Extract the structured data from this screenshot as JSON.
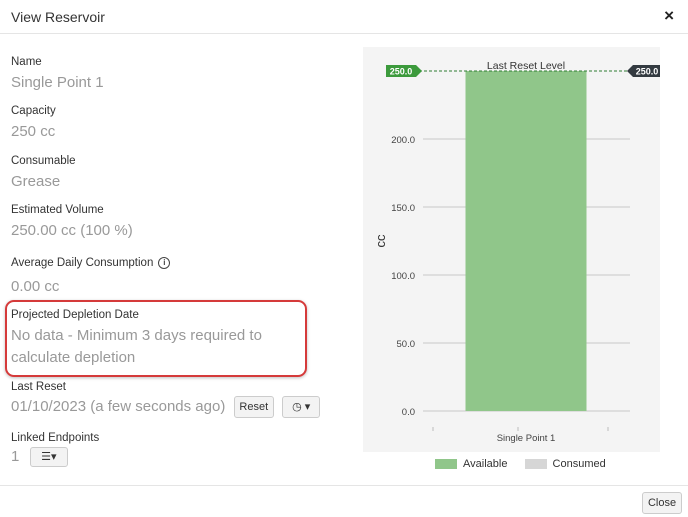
{
  "dialog": {
    "title": "View Reservoir",
    "close_symbol": "×"
  },
  "fields": {
    "name": {
      "label": "Name",
      "value": "Single Point 1"
    },
    "capacity": {
      "label": "Capacity",
      "value": "250 cc"
    },
    "consumable": {
      "label": "Consumable",
      "value": "Grease"
    },
    "estimated_volume": {
      "label": "Estimated Volume",
      "value": "250.00 cc (100 %)"
    },
    "avg_daily": {
      "label": "Average Daily Consumption",
      "info_symbol": "i",
      "value": "0.00 cc"
    },
    "projected": {
      "label": "Projected Depletion Date",
      "value_line1": "No data - Minimum 3 days required to",
      "value_line2": "calculate depletion"
    },
    "last_reset": {
      "label": "Last Reset",
      "value": "01/10/2023 (a few seconds ago)",
      "reset_button": "Reset",
      "history_button": "◷ ▾"
    },
    "linked": {
      "label": "Linked Endpoints",
      "value": "1",
      "list_button": "☰▾"
    }
  },
  "chart_data": {
    "type": "bar",
    "categories": [
      "Single Point 1"
    ],
    "series": [
      {
        "name": "Available",
        "values": [
          250.0
        ],
        "color": "#90c68a"
      },
      {
        "name": "Consumed",
        "values": [
          0.0
        ],
        "color": "#d6d6d6"
      }
    ],
    "ylabel": "cc",
    "ylim": [
      0,
      250
    ],
    "y_ticks": [
      "0.0",
      "50.0",
      "100.0",
      "150.0",
      "200.0"
    ],
    "reference_line": {
      "label": "Last Reset Level",
      "value": 250.0,
      "left_badge": "250.0",
      "right_badge": "250.0",
      "left_color": "#3c9a3c",
      "right_color": "#333a40"
    },
    "legend_position": "bottom",
    "grid": true
  },
  "footer": {
    "close_label": "Close"
  }
}
